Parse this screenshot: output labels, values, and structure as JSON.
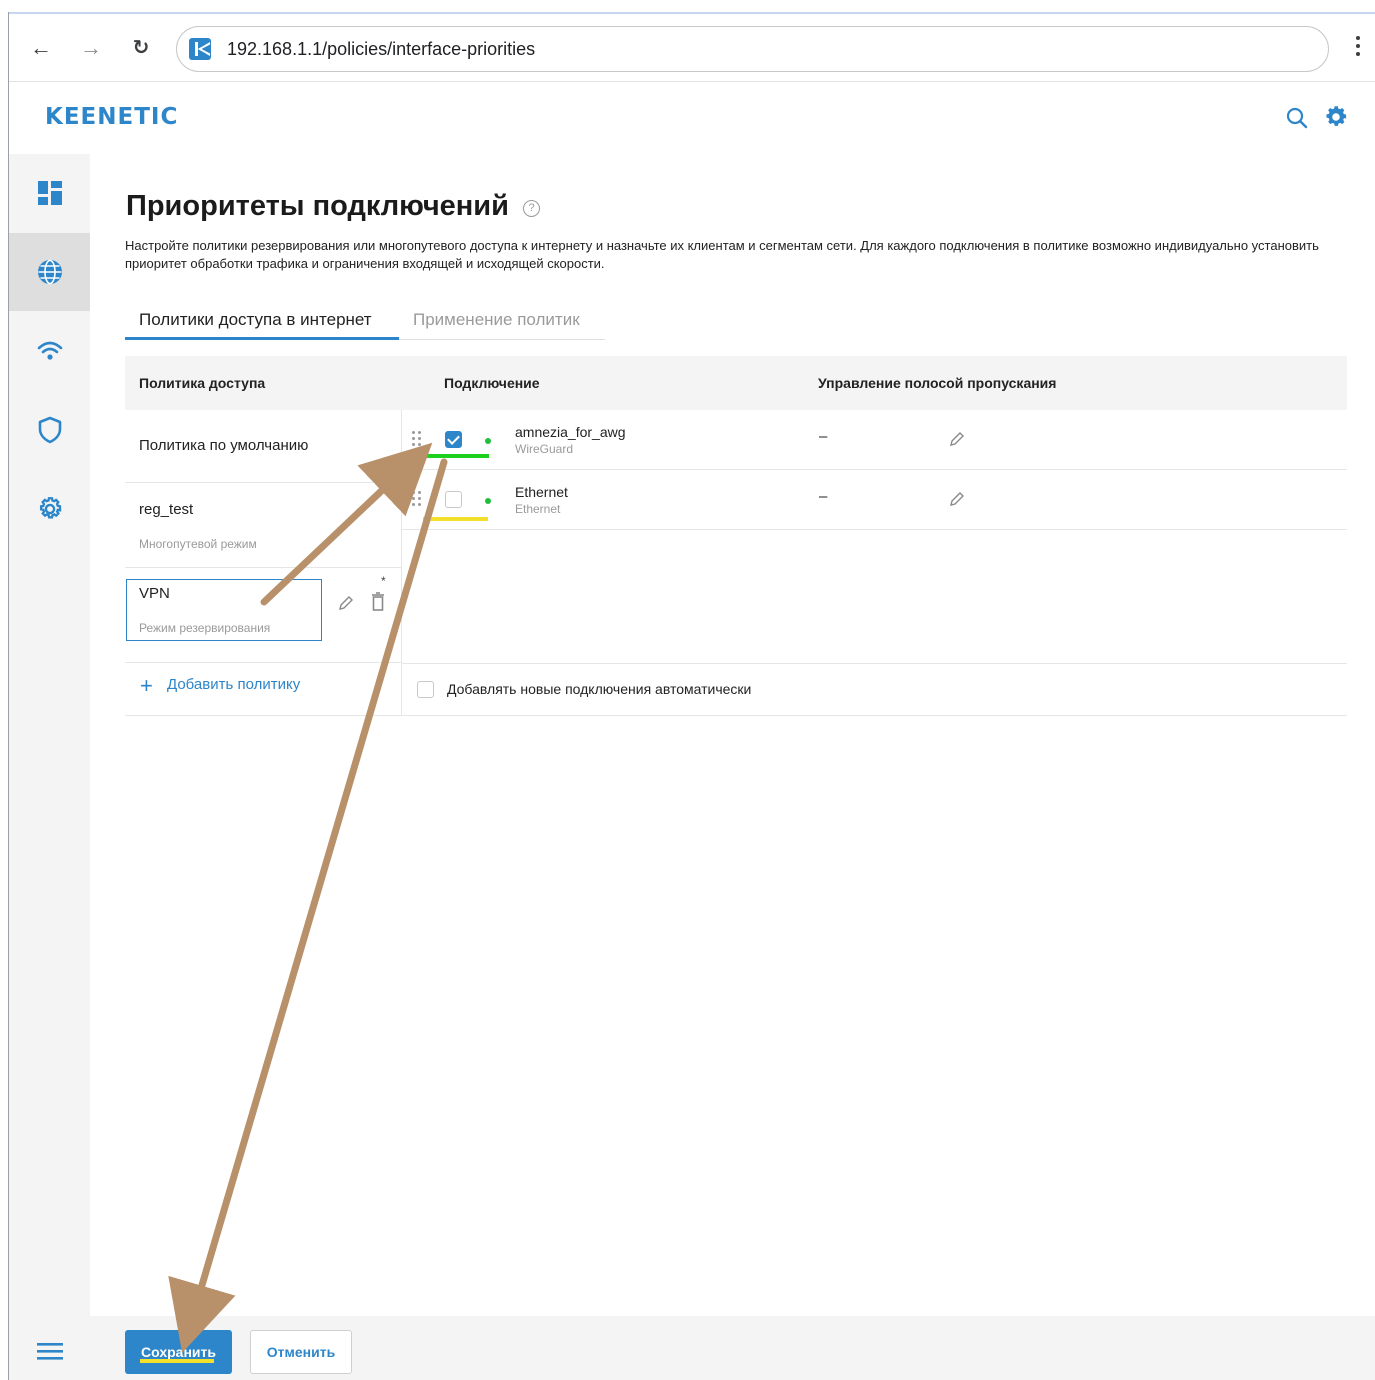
{
  "browser": {
    "url": "192.168.1.1/policies/interface-priorities",
    "back_icon": "arrow-left-icon",
    "forward_icon": "arrow-right-icon",
    "reload_icon": "reload-icon"
  },
  "header": {
    "logo": "KEENETIC",
    "accent_color": "#2d86c9"
  },
  "sidebar": {
    "items": [
      {
        "icon": "dashboard-icon"
      },
      {
        "icon": "globe-icon",
        "active": true
      },
      {
        "icon": "wifi-icon"
      },
      {
        "icon": "shield-icon"
      },
      {
        "icon": "gear-icon"
      }
    ],
    "menu_icon": "hamburger-icon"
  },
  "page": {
    "title": "Приоритеты подключений",
    "description": "Настройте политики резервирования или многопутевого доступа к интернету и назначьте их клиентам и сегментам сети. Для каждого подключения в политике возможно индивидуально установить приоритет обработки трафика и ограничения входящей и исходящей скорости.",
    "tabs": [
      {
        "label": "Политики доступа в интернет",
        "active": true
      },
      {
        "label": "Применение политик",
        "active": false
      }
    ]
  },
  "table": {
    "headers": {
      "policy": "Политика доступа",
      "connection": "Подключение",
      "bandwidth": "Управление полосой пропускания"
    },
    "policies": [
      {
        "name": "Политика по умолчанию",
        "mode": ""
      },
      {
        "name": "reg_test",
        "mode": "Многопутевой режим"
      },
      {
        "name": "VPN",
        "mode": "Режим резервирования",
        "selected": true,
        "star": "*"
      }
    ],
    "connections": [
      {
        "name": "amnezia_for_awg",
        "type": "WireGuard",
        "checked": true,
        "status_color": "#1fbf3a",
        "bandwidth": "–"
      },
      {
        "name": "Ethernet",
        "type": "Ethernet",
        "checked": false,
        "status_color": "#1fbf3a",
        "bandwidth": "–"
      }
    ],
    "add_policy": "Добавить политику",
    "auto_add": "Добавлять новые подключения автоматически"
  },
  "footer": {
    "save": "Сохранить",
    "cancel": "Отменить"
  },
  "annotations": {
    "arrow_color": "#b8916a",
    "highlight_green": "#1fd11f",
    "highlight_yellow": "#f2e02a"
  }
}
